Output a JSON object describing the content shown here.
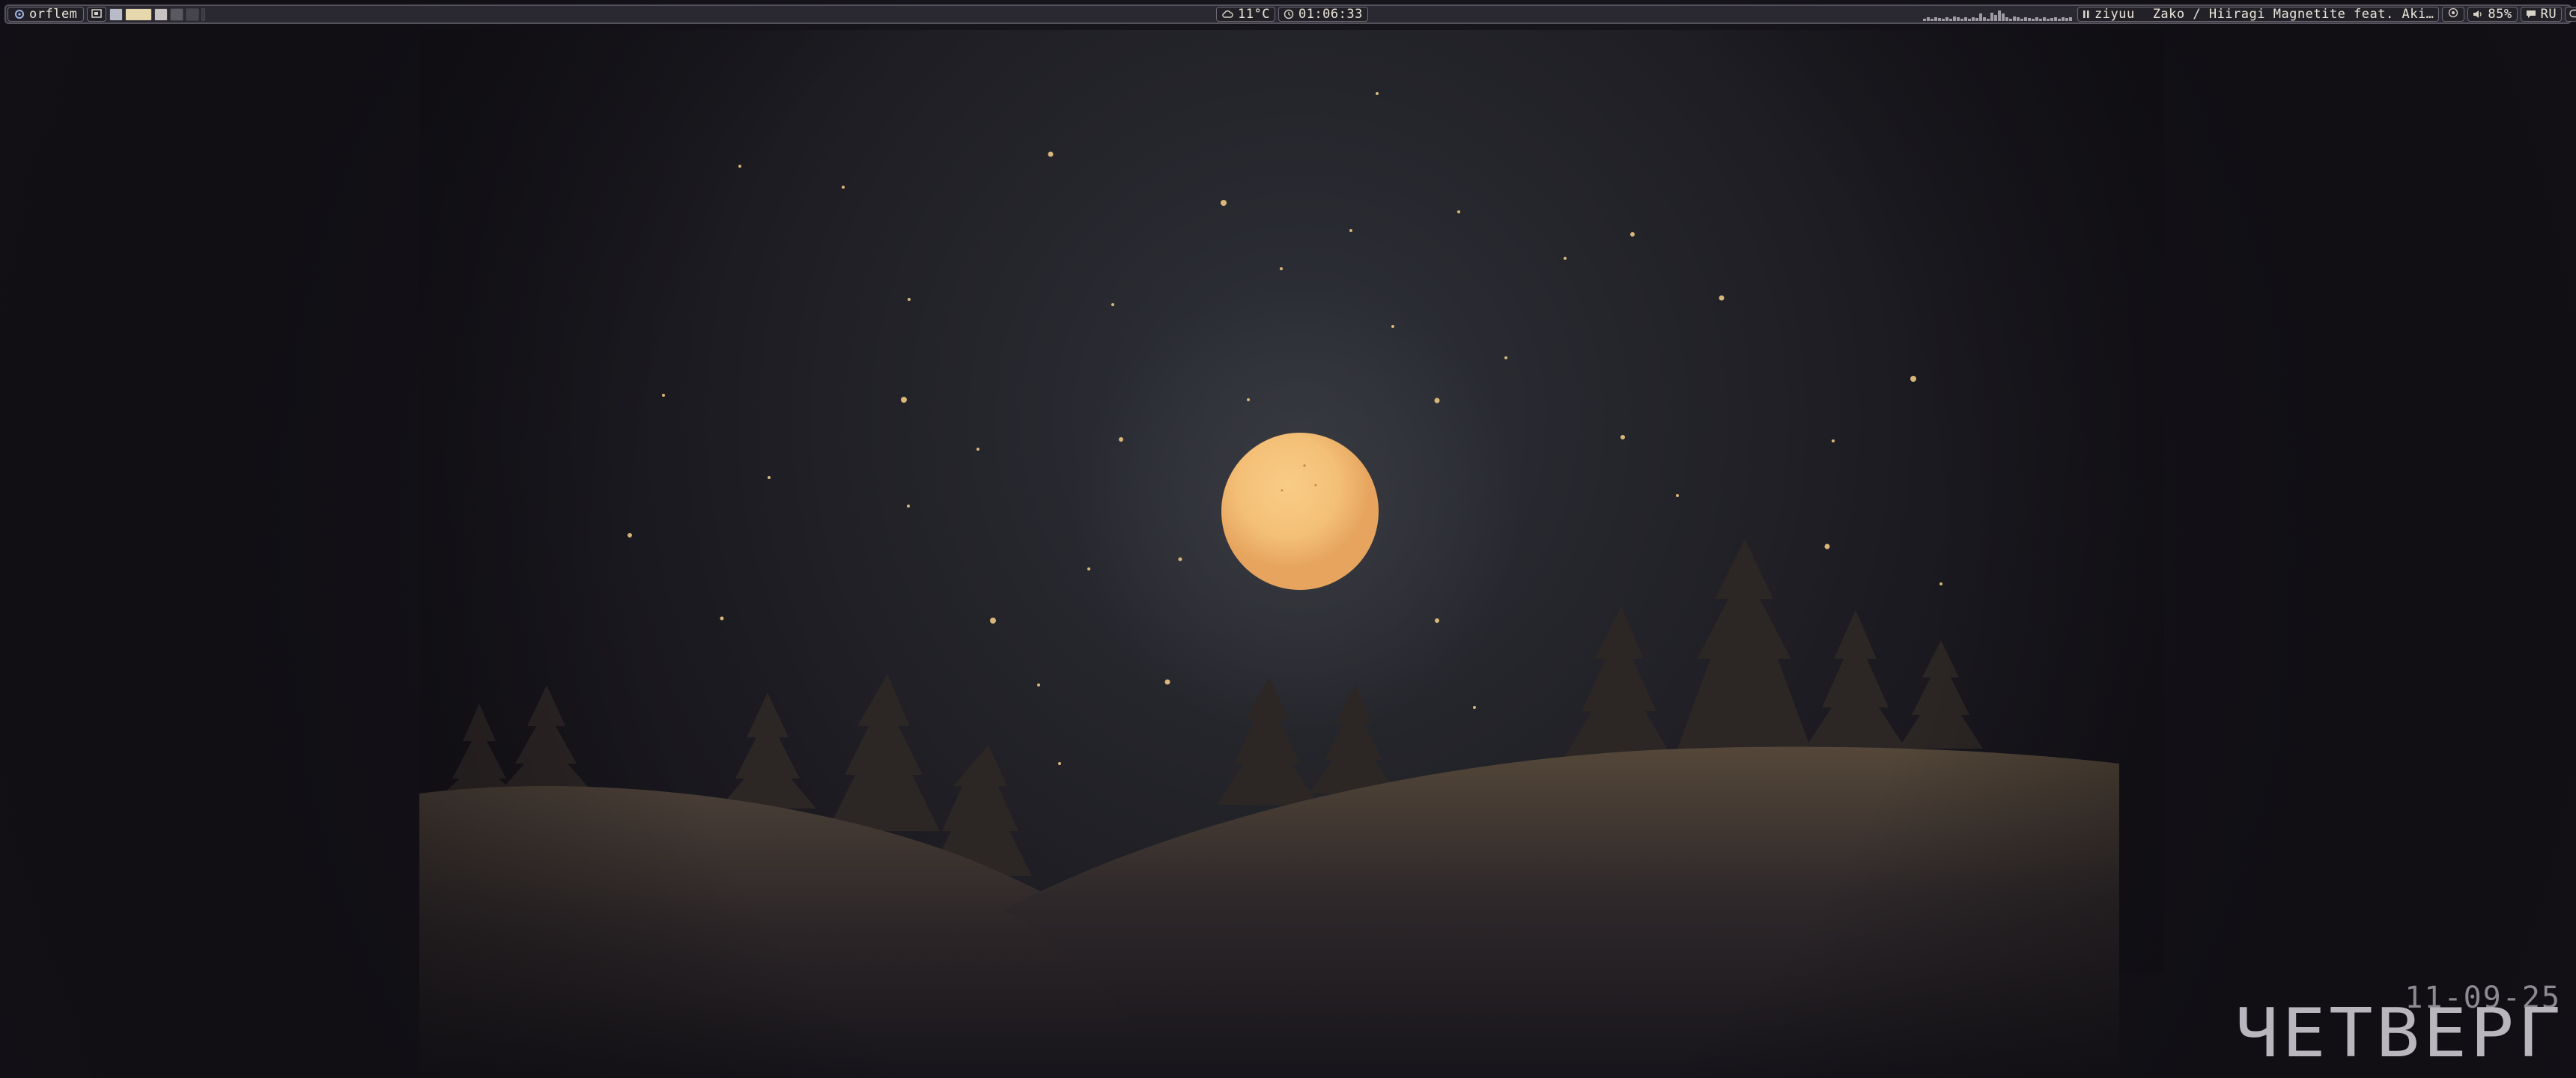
{
  "panel": {
    "workspace_name": "orflem",
    "workspace_icon": "distro-logo-icon",
    "layout_icon": "tiling-layout-icon",
    "tags": [
      {
        "color": "#b9bcc8"
      },
      {
        "color": "#e6d7ad"
      },
      {
        "color": "#c7c3c3"
      },
      {
        "color": "#5a5860"
      },
      {
        "color": "#47454c"
      }
    ],
    "weather": {
      "icon": "cloud-icon",
      "temperature": "11°C"
    },
    "clock": {
      "icon": "clock-icon",
      "time": "01:06:33"
    },
    "network": {
      "icon": "network-graph",
      "levels": [
        0.2,
        0.3,
        0.2,
        0.3,
        0.25,
        0.2,
        0.3,
        0.2,
        0.4,
        0.3,
        0.2,
        0.3,
        0.2,
        0.3,
        0.25,
        0.6,
        0.3,
        0.2,
        0.7,
        0.5,
        0.9,
        0.6,
        0.3,
        0.2,
        0.4,
        0.3,
        0.2,
        0.3,
        0.25,
        0.2,
        0.3,
        0.2,
        0.3,
        0.2,
        0.25,
        0.3,
        0.2,
        0.3,
        0.25,
        0.3
      ]
    },
    "player": {
      "state_icon": "pause-icon",
      "source": "ziyuu",
      "track": "Zako / Hiiragi Magnetite feat. Aki…"
    },
    "brightness": {
      "icon": "brightness-icon"
    },
    "volume": {
      "icon": "speaker-icon",
      "level": "85%"
    },
    "keyboard": {
      "icon": "keyboard-icon",
      "layout": "RU"
    },
    "toggle": {
      "icon": "toggle-icon"
    }
  },
  "desktop_widget": {
    "day_name": "ЧЕТВЕРГ",
    "date": "11-09-25"
  },
  "colors": {
    "sky_dark": "#17151c",
    "sky_mid": "#2a2c32",
    "moon": "#f2be77",
    "hill": "#4a3e35",
    "tree": "#2c2625",
    "star": "#d9b77a",
    "bar_bg": "#2a2830"
  }
}
